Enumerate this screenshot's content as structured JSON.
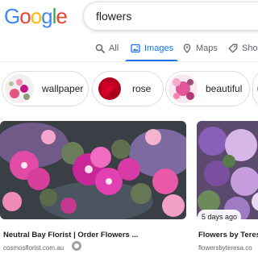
{
  "brand": {
    "logo_letters": [
      "G",
      "o",
      "o",
      "g",
      "l",
      "e"
    ],
    "logo_colors": [
      "#4285F4",
      "#EA4335",
      "#FBBC05",
      "#4285F4",
      "#34A853",
      "#EA4335"
    ]
  },
  "search": {
    "query": "flowers"
  },
  "tabs": [
    {
      "label": "All",
      "icon": "search-icon",
      "active": false
    },
    {
      "label": "Images",
      "icon": "image-icon",
      "active": true
    },
    {
      "label": "Maps",
      "icon": "map-pin-icon",
      "active": false
    },
    {
      "label": "Shop",
      "icon": "tag-icon",
      "active": false
    }
  ],
  "chips": [
    {
      "label": "wallpaper"
    },
    {
      "label": "rose"
    },
    {
      "label": "beautiful"
    }
  ],
  "results": [
    {
      "title": "Neutral Bay Florist | Order Flowers ...",
      "site": "cosmosflorist.com.au",
      "badge": ""
    },
    {
      "title": "Flowers by Teresa",
      "site": "flowersbyteresa.co",
      "badge": "5 days ago"
    }
  ],
  "colors": {
    "accent": "#1a73e8",
    "tab_text": "#5f6368",
    "title_text": "#202124"
  }
}
